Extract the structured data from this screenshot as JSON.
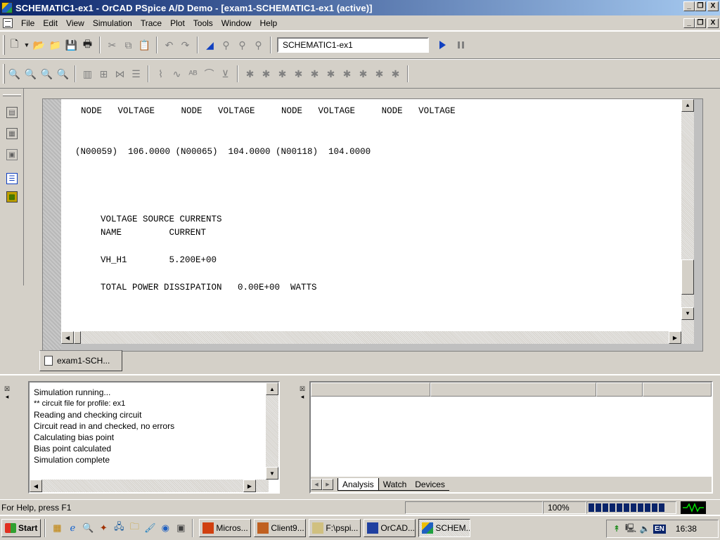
{
  "window": {
    "title": "SCHEMATIC1-ex1 - OrCAD PSpice A/D Demo  - [exam1-SCHEMATIC1-ex1 (active)]",
    "minimize_glyph": "_",
    "restore_glyph": "❐",
    "close_glyph": "X"
  },
  "menu": [
    "File",
    "Edit",
    "View",
    "Simulation",
    "Trace",
    "Plot",
    "Tools",
    "Window",
    "Help"
  ],
  "toolbar": {
    "profile_value": "SCHEMATIC1-ex1"
  },
  "output": {
    "lines": [
      "NODE   VOLTAGE     NODE   VOLTAGE     NODE   VOLTAGE     NODE   VOLTAGE",
      "(N00059)  106.0000 (N00065)  104.0000 (N00118)  104.0000",
      "VOLTAGE SOURCE CURRENTS",
      "NAME         CURRENT",
      "VH_H1        5.200E+00",
      "TOTAL POWER DISSIPATION   0.00E+00  WATTS"
    ]
  },
  "doc_tab": {
    "label": "exam1-SCH..."
  },
  "sim_log": [
    "Simulation running...",
    "** circuit file for profile: ex1",
    "Reading and checking circuit",
    "Circuit read in and checked, no errors",
    "Calculating bias point",
    "Bias point calculated",
    "Simulation complete"
  ],
  "watch_tabs": [
    "Analysis",
    "Watch",
    "Devices"
  ],
  "status": {
    "help_text": "For Help, press F1",
    "zoom": "100%",
    "progress_fraction": 1.0
  },
  "taskbar": {
    "start_label": "Start",
    "tasks": [
      "Micros...",
      "Client9...",
      "F:\\pspi...",
      "OrCAD...",
      "SCHEM..."
    ],
    "active_task_index": 4,
    "language": "EN",
    "clock": "16:38"
  },
  "colors": {
    "title_active": "#0a246a",
    "accent_blue": "#1040c0",
    "face": "#d4d0c8"
  }
}
